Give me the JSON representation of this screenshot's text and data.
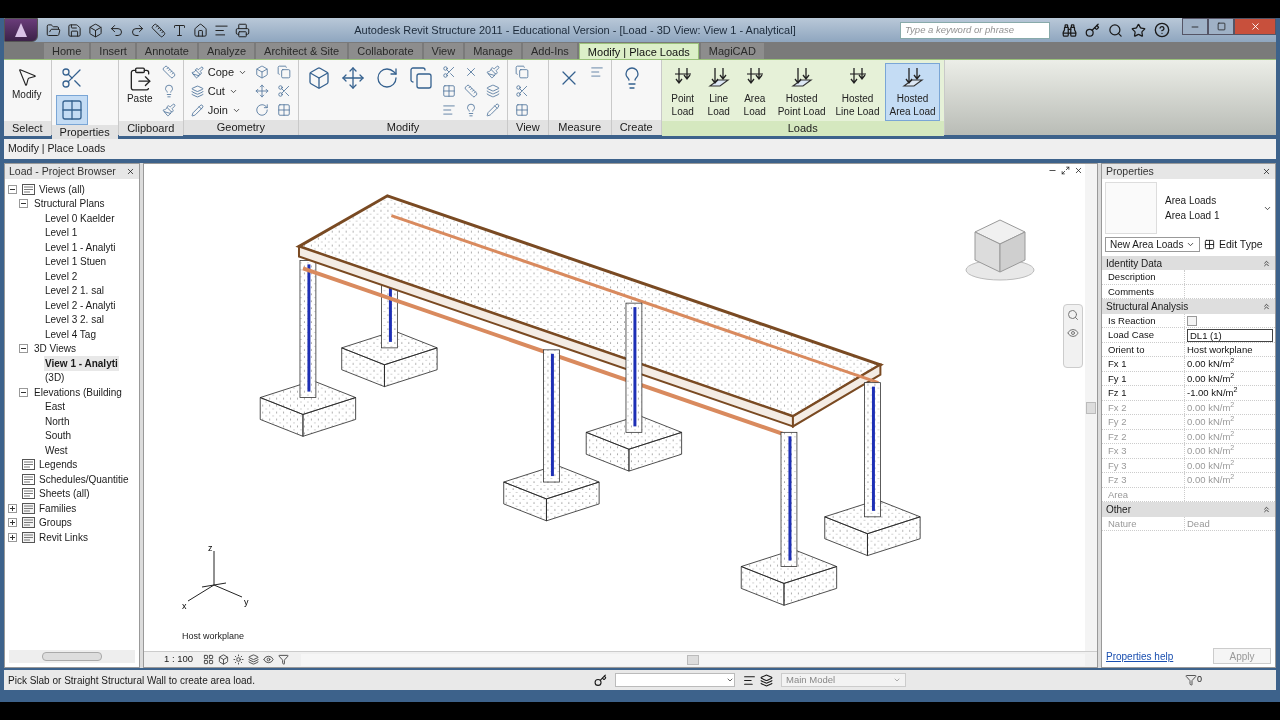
{
  "window": {
    "title": "Autodesk Revit Structure 2011 - Educational Version - [Load - 3D View: View 1 - Analytical]"
  },
  "search": {
    "placeholder": "Type a keyword or phrase"
  },
  "tabs": [
    {
      "label": "Home",
      "selected": false
    },
    {
      "label": "Insert",
      "selected": false
    },
    {
      "label": "Annotate",
      "selected": false
    },
    {
      "label": "Analyze",
      "selected": false
    },
    {
      "label": "Architect & Site",
      "selected": false
    },
    {
      "label": "Collaborate",
      "selected": false
    },
    {
      "label": "View",
      "selected": false
    },
    {
      "label": "Manage",
      "selected": false
    },
    {
      "label": "Add-Ins",
      "selected": false
    },
    {
      "label": "Modify | Place Loads",
      "selected": true
    },
    {
      "label": "MagiCAD",
      "selected": false
    }
  ],
  "ribbon": [
    {
      "label": "Select",
      "tools": [
        {
          "kind": "large",
          "label": [
            "Modify"
          ],
          "selected": false
        }
      ]
    },
    {
      "label": "Properties",
      "tools": [
        {
          "kind": "icon-large",
          "selected": false
        },
        {
          "kind": "icon-large",
          "selected": true
        }
      ]
    },
    {
      "label": "Clipboard",
      "tools": [
        {
          "kind": "large",
          "label": [
            "Paste"
          ],
          "selected": false
        },
        {
          "kind": "icon",
          "selected": false
        },
        {
          "kind": "icon",
          "selected": false
        },
        {
          "kind": "icon",
          "selected": false
        }
      ]
    },
    {
      "label": "Geometry",
      "tools": [
        {
          "kind": "small",
          "label": [
            "Cope"
          ],
          "selected": false
        },
        {
          "kind": "small",
          "label": [
            "Cut"
          ],
          "selected": false
        },
        {
          "kind": "small",
          "label": [
            "Join"
          ],
          "selected": false
        },
        {
          "kind": "icon",
          "selected": false
        },
        {
          "kind": "icon",
          "selected": false
        },
        {
          "kind": "icon",
          "selected": false
        },
        {
          "kind": "icon",
          "selected": false
        },
        {
          "kind": "icon",
          "selected": false
        },
        {
          "kind": "icon",
          "selected": false
        }
      ]
    },
    {
      "label": "Modify",
      "tools": [
        {
          "kind": "icon-large",
          "selected": false
        },
        {
          "kind": "icon-large",
          "selected": false
        },
        {
          "kind": "icon-large",
          "selected": false
        },
        {
          "kind": "icon-large",
          "selected": false
        },
        {
          "kind": "icon",
          "selected": false
        },
        {
          "kind": "icon",
          "selected": false
        },
        {
          "kind": "icon",
          "selected": false
        },
        {
          "kind": "icon",
          "selected": false
        },
        {
          "kind": "icon",
          "selected": false
        },
        {
          "kind": "icon",
          "selected": false
        },
        {
          "kind": "icon",
          "selected": false
        },
        {
          "kind": "icon",
          "selected": false
        },
        {
          "kind": "icon",
          "selected": false
        }
      ]
    },
    {
      "label": "View",
      "tools": [
        {
          "kind": "icon",
          "selected": false
        },
        {
          "kind": "icon",
          "selected": false
        },
        {
          "kind": "icon",
          "selected": false
        }
      ]
    },
    {
      "label": "Measure",
      "tools": [
        {
          "kind": "icon",
          "selected": false
        },
        {
          "kind": "icon-large",
          "selected": false
        }
      ]
    },
    {
      "label": "Create",
      "tools": [
        {
          "kind": "icon-large",
          "selected": false
        }
      ]
    },
    {
      "label": "Loads",
      "tools": [
        {
          "kind": "large",
          "label": [
            "Point",
            "Load"
          ],
          "selected": false
        },
        {
          "kind": "large",
          "label": [
            "Line",
            "Load"
          ],
          "selected": false
        },
        {
          "kind": "large",
          "label": [
            "Area",
            "Load"
          ],
          "selected": false
        },
        {
          "kind": "large",
          "label": [
            "Hosted",
            "Point Load"
          ],
          "selected": false
        },
        {
          "kind": "large",
          "label": [
            "Hosted",
            "Line Load"
          ],
          "selected": false
        },
        {
          "kind": "large",
          "label": [
            "Hosted",
            "Area Load"
          ],
          "selected": true
        }
      ]
    }
  ],
  "options_bar": {
    "text": "Modify | Place Loads"
  },
  "project_browser": {
    "title": "Load - Project Browser",
    "tree": [
      {
        "label": "Views (all)",
        "expanded": true,
        "selected": false,
        "children": [
          {
            "label": "Structural Plans",
            "expanded": true,
            "selected": false,
            "children": [
              {
                "label": "Level 0 Kaelder",
                "selected": false
              },
              {
                "label": "Level 1",
                "selected": false
              },
              {
                "label": "Level 1 - Analyti",
                "selected": false
              },
              {
                "label": "Level 1 Stuen",
                "selected": false
              },
              {
                "label": "Level 2",
                "selected": false
              },
              {
                "label": "Level 2 1. sal",
                "selected": false
              },
              {
                "label": "Level 2 - Analyti",
                "selected": false
              },
              {
                "label": "Level 3 2. sal",
                "selected": false
              },
              {
                "label": "Level 4 Tag",
                "selected": false
              }
            ]
          },
          {
            "label": "3D Views",
            "expanded": true,
            "selected": false,
            "children": [
              {
                "label": "View 1 - Analyti",
                "selected": true
              },
              {
                "label": "(3D)",
                "selected": false
              }
            ]
          },
          {
            "label": "Elevations (Building",
            "expanded": true,
            "selected": false,
            "children": [
              {
                "label": "East",
                "selected": false
              },
              {
                "label": "North",
                "selected": false
              },
              {
                "label": "South",
                "selected": false
              },
              {
                "label": "West",
                "selected": false
              }
            ]
          }
        ]
      },
      {
        "label": "Legends",
        "selected": false
      },
      {
        "label": "Schedules/Quantitie",
        "selected": false
      },
      {
        "label": "Sheets (all)",
        "selected": false
      },
      {
        "label": "Families",
        "expanded": false,
        "selected": false
      },
      {
        "label": "Groups",
        "expanded": false,
        "selected": false
      },
      {
        "label": "Revit Links",
        "expanded": false,
        "selected": false
      }
    ]
  },
  "viewport": {
    "workplane_label": "Host workplane",
    "axis_labels": {
      "x": "x",
      "y": "y",
      "z": "z"
    },
    "scale": "1 : 100"
  },
  "properties": {
    "title": "Properties",
    "family": "Area Loads",
    "type": "Area Load 1",
    "type_selector": "New Area Loads",
    "edit_type": "Edit Type",
    "groups": [
      {
        "title": "Identity Data",
        "expanded": true,
        "rows": [
          {
            "kind": "text",
            "label": "Description",
            "disabled": false
          },
          {
            "kind": "text",
            "label": "Comments",
            "disabled": false
          }
        ]
      },
      {
        "title": "Structural Analysis",
        "expanded": true,
        "rows": [
          {
            "kind": "checkbox",
            "label": "Is Reaction",
            "checked": false,
            "disabled": false
          },
          {
            "kind": "field",
            "label": "Load Case",
            "value": "DL1 (1)",
            "disabled": false
          },
          {
            "kind": "text",
            "label": "Orient to",
            "value": "Host workplane",
            "disabled": false
          },
          {
            "kind": "text",
            "label": "Fx 1",
            "value": "0.00 kN/m$^{2}$",
            "disabled": false
          },
          {
            "kind": "text",
            "label": "Fy 1",
            "value": "0.00 kN/m$^{2}$",
            "disabled": false
          },
          {
            "kind": "text",
            "label": "Fz 1",
            "value": "-1.00 kN/m$^{2}$",
            "disabled": false
          },
          {
            "kind": "text",
            "label": "Fx 2",
            "value": "0.00 kN/m$^{2}$",
            "disabled": true
          },
          {
            "kind": "text",
            "label": "Fy 2",
            "value": "0.00 kN/m$^{2}$",
            "disabled": true
          },
          {
            "kind": "text",
            "label": "Fz 2",
            "value": "0.00 kN/m$^{2}$",
            "disabled": true
          },
          {
            "kind": "text",
            "label": "Fx 3",
            "value": "0.00 kN/m$^{2}$",
            "disabled": true
          },
          {
            "kind": "text",
            "label": "Fy 3",
            "value": "0.00 kN/m$^{2}$",
            "disabled": true
          },
          {
            "kind": "text",
            "label": "Fz 3",
            "value": "0.00 kN/m$^{2}$",
            "disabled": true
          },
          {
            "kind": "text",
            "label": "Area",
            "disabled": true
          }
        ]
      },
      {
        "title": "Other",
        "expanded": true,
        "rows": [
          {
            "kind": "text",
            "label": "Nature",
            "value": "Dead",
            "disabled": true
          }
        ]
      }
    ],
    "help_link": "Properties help",
    "apply": {
      "label": "Apply",
      "disabled": true
    }
  },
  "status_bar": {
    "message": "Pick Slab or Straight Structural Wall to create area load.",
    "model": "Main Model",
    "filter_count": "0"
  }
}
